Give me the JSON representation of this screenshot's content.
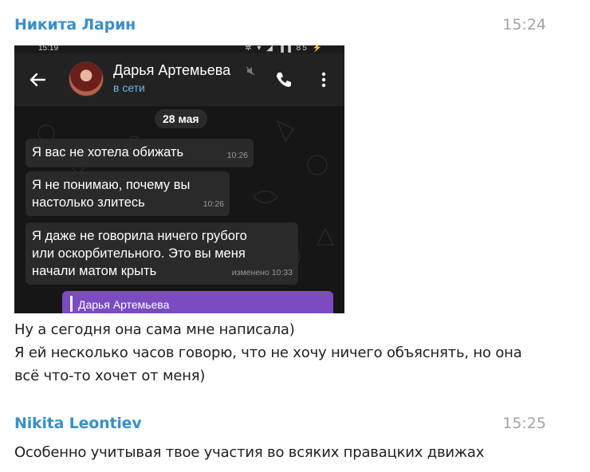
{
  "messages": [
    {
      "author": "Никита Ларин",
      "time": "15:24",
      "lines": [
        "Ну а сегодня она сама мне написала)",
        "Я ей несколько часов говорю, что не хочу ничего объяснять, но она",
        "всё что-то хочет от меня)"
      ]
    },
    {
      "author": "Nikita Leontiev",
      "time": "15:25",
      "lines": [
        "Особенно учитывая твое участия во всяких правацких движах"
      ]
    }
  ],
  "screenshot": {
    "status_bar": {
      "time": "15:19",
      "right": "✲ ▾ ◢ ▐▐ 85 ⚡"
    },
    "contact": {
      "name": "Дарья Артемьева",
      "status": "в сети"
    },
    "date": "28 мая",
    "bubbles": [
      {
        "lines": [
          "Я вас не хотела обижать"
        ],
        "time": "10:26"
      },
      {
        "lines": [
          "Я не понимаю, почему вы",
          "настолько злитесь"
        ],
        "time": "10:26"
      },
      {
        "lines": [
          "Я даже не говорила ничего грубого",
          "или оскорбительного. Это вы меня",
          "начали матом крыть"
        ],
        "time": "изменено 10:33"
      }
    ],
    "reply_preview_name": "Дарья Артемьева"
  },
  "colors": {
    "author_name": "#3a8fc7",
    "time": "#a3a3a3",
    "phone_bg": "#161616",
    "bubble_bg": "#2a2a2a",
    "online_status": "#6cb6ef",
    "reply_bg": "#7a4bc1"
  }
}
